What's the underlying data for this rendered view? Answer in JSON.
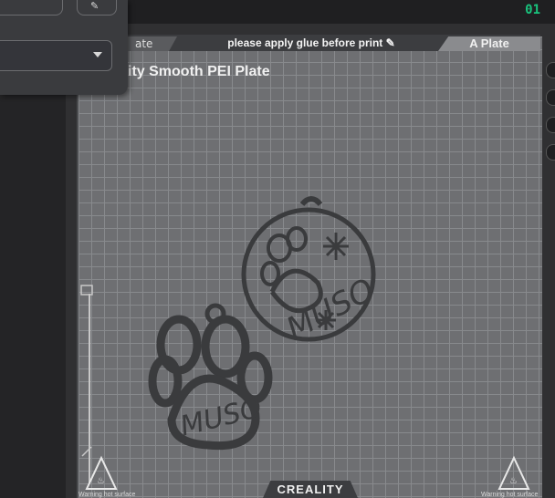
{
  "topbar": {
    "counter": "01"
  },
  "plate": {
    "left_tab_label": "ate",
    "notice": "please apply glue before print",
    "right_tab_label": "A Plate",
    "title": "ity Smooth PEI Plate",
    "brand": "CREALITY",
    "warning_label": "Warning hot surface"
  },
  "objects": [
    {
      "name": "ornament",
      "text": "MUSO"
    },
    {
      "name": "paw",
      "text": "MUSO"
    }
  ],
  "colors": {
    "plate": "#6e6f72",
    "grid": "#888a8d",
    "model": "#3a3b3d",
    "counter": "#19c37d"
  }
}
